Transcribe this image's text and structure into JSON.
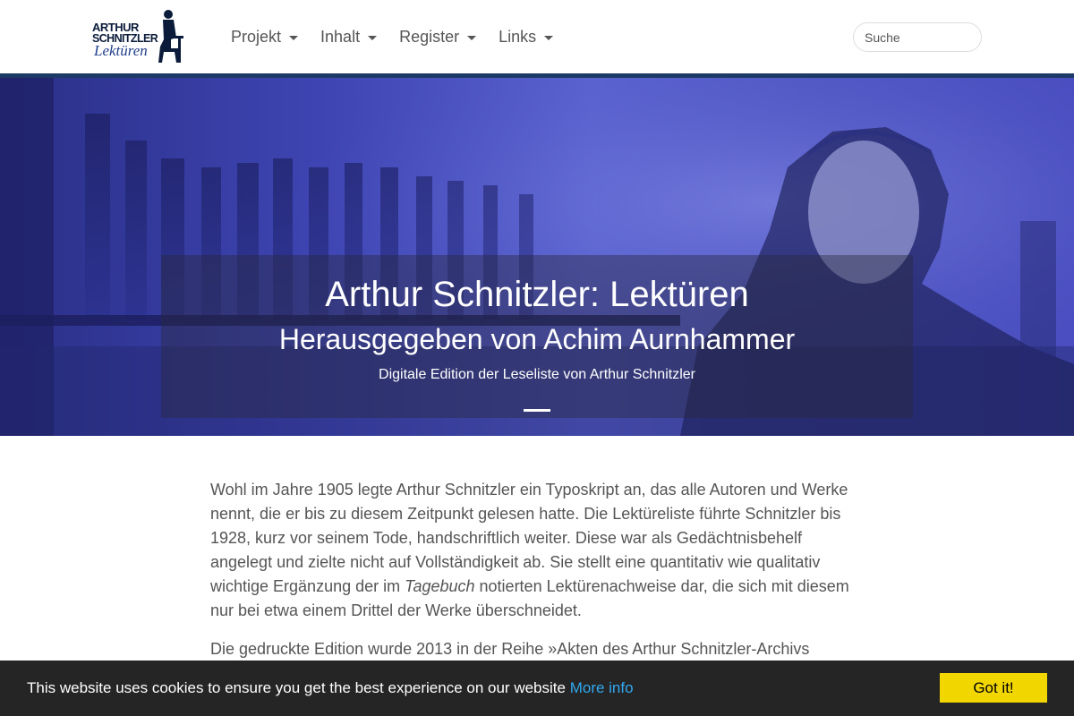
{
  "header": {
    "logo": {
      "line1": "ARTHUR",
      "line2": "SCHNITZLER",
      "line3": "Lektüren"
    },
    "nav": [
      {
        "label": "Projekt",
        "icon": "caret-down-icon"
      },
      {
        "label": "Inhalt",
        "icon": "caret-down-icon"
      },
      {
        "label": "Register",
        "icon": "caret-down-icon"
      },
      {
        "label": "Links",
        "icon": "caret-down-icon"
      }
    ],
    "search": {
      "placeholder": "Suche",
      "value": ""
    }
  },
  "hero": {
    "title": "Arthur Schnitzler: Lektüren",
    "subtitle": "Herausgegeben von Achim Aurnhammer",
    "description": "Digitale Edition der Leseliste von Arthur Schnitzler"
  },
  "content": {
    "p1_before": "Wohl im Jahre 1905 legte Arthur Schnitzler ein Typoskript an, das alle Autoren und Werke nennt, die er bis zu diesem Zeitpunkt gelesen hatte. Die Lektüreliste führte Schnitzler bis 1928, kurz vor seinem Tode, handschriftlich weiter. Diese war als Gedächtnisbehelf angelegt und zielte nicht auf Vollständigkeit ab. Sie stellt eine quantitativ wie qualitativ wichtige Ergänzung der im ",
    "p1_italic": "Tagebuch",
    "p1_after": " notierten Lektürenachweise dar, die sich mit diesem nur bei etwa einem Drittel der Werke überschneidet.",
    "p2": "Die gedruckte Edition wurde 2013 in der Reihe »Akten des Arthur Schnitzler-Archivs"
  },
  "cookie": {
    "message": "This website uses cookies to ensure you get the best experience on our website",
    "link": "More info",
    "button": "Got it!"
  },
  "colors": {
    "navbar_stripe": "#1d3a66",
    "hero_tint": "#4a52c4",
    "cookie_bg": "#252525",
    "cookie_button": "#f1d600",
    "cookie_link": "#31a8f0"
  }
}
